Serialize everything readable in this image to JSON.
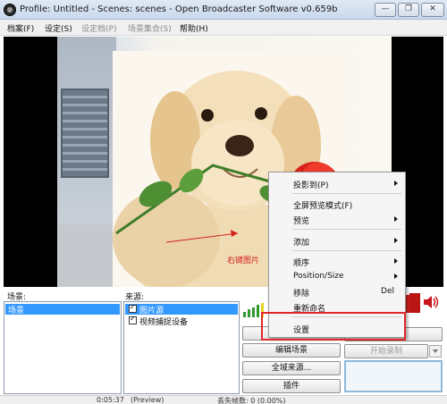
{
  "window": {
    "title": "Profile: Untitled - Scenes: scenes - Open Broadcaster Software v0.659b",
    "min_glyph": "—",
    "max_glyph": "❐",
    "close_glyph": "✕"
  },
  "menubar": {
    "items": [
      {
        "label": "档案(F)",
        "enabled": true
      },
      {
        "label": "设定(S)",
        "enabled": true
      },
      {
        "label": "设定档(P)",
        "enabled": false
      },
      {
        "label": "场景集合(S)",
        "enabled": false
      },
      {
        "label": "帮助(H)",
        "enabled": true
      }
    ]
  },
  "preview": {
    "annotation": "右键图片"
  },
  "scenes": {
    "label": "场景:",
    "items": [
      {
        "label": "场景",
        "selected": true
      }
    ]
  },
  "sources": {
    "label": "来源:",
    "items": [
      {
        "label": "图片源",
        "checked": true,
        "selected": true
      },
      {
        "label": "视频捕捉设备",
        "checked": true,
        "selected": false
      }
    ]
  },
  "buttons": {
    "edit_scene": "编辑场景",
    "global_sources": "全域来源...",
    "plugins": "插件",
    "start_recording": "开始录制"
  },
  "context_menu": {
    "items": [
      {
        "label": "投影到(P)",
        "submenu": true
      },
      {
        "label": "全屏预览模式(F)",
        "submenu": false
      },
      {
        "label": "预览",
        "submenu": true
      },
      {
        "label": "添加",
        "submenu": true
      },
      {
        "label": "顺序",
        "submenu": true
      },
      {
        "label": "Position/Size",
        "submenu": true
      },
      {
        "label": "移除",
        "shortcut": "Del"
      },
      {
        "label": "重新命名"
      },
      {
        "label": "设置"
      }
    ]
  },
  "statusbar": {
    "time": "0:05:37",
    "preview": "(Preview)",
    "dropped": "丢失帧数: 0 (0.00%)"
  },
  "colors": {
    "accent": "#3399ff",
    "annotation_red": "#e0282a"
  }
}
